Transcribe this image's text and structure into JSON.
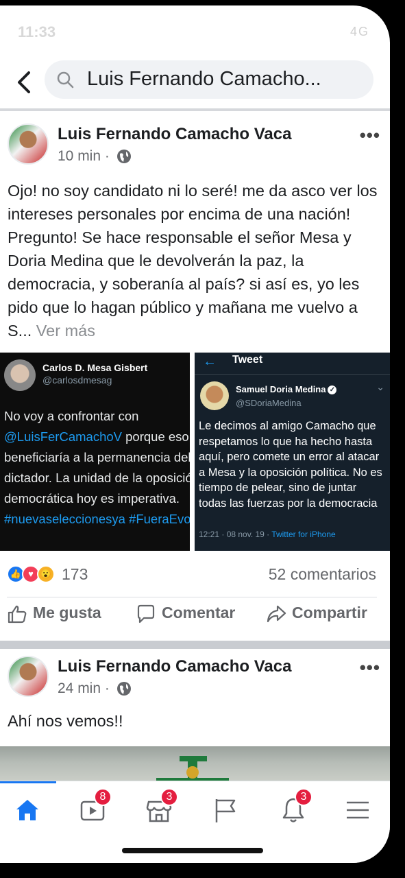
{
  "status": {
    "time": "11:33",
    "right": "4G"
  },
  "search": {
    "query": "Luis Fernando Camacho..."
  },
  "post1": {
    "author": "Luis Fernando Camacho Vaca",
    "time": "10 min",
    "text": "Ojo! no soy candidato ni lo seré! me da asco ver los intereses personales por encima de una nación!  Pregunto!  Se hace responsable el señor Mesa y Doria Medina que le devolverán la paz, la democracia, y soberanía al país? si así es, yo les pido que lo hagan público y mañana me vuelvo a S...",
    "see_more": "Ver más",
    "tweet_left": {
      "name": "Carlos D. Mesa Gisbert",
      "handle": "@carlosdmesag",
      "line1": "No voy a confrontar con",
      "mention": "@LuisFerCamachoV",
      "line2": " porque eso",
      "line3": "beneficiaría a la permanencia del",
      "line4": "dictador. La unidad de la oposición",
      "line5": "democrática hoy es imperativa.",
      "hashtags": "#nuevaseleccionesya #FueraEvo"
    },
    "tweet_right": {
      "header": "Tweet",
      "name": "Samuel Doria Medina",
      "handle": "@SDoriaMedina",
      "text": "Le decimos al amigo Camacho que respetamos lo que ha hecho hasta aquí, pero comete un error al atacar a Mesa y la oposición política. No es tiempo de pelear, sino de juntar todas las fuerzas por la democracia",
      "timestamp": "12:21 · 08 nov. 19 · ",
      "source": "Twitter for iPhone"
    },
    "reaction_count": "173",
    "comments": "52 comentarios",
    "actions": {
      "like": "Me gusta",
      "comment": "Comentar",
      "share": "Compartir"
    }
  },
  "post2": {
    "author": "Luis Fernando Camacho Vaca",
    "time": "24 min",
    "text": "Ahí nos vemos!!"
  },
  "tabbar": {
    "badges": {
      "watch": "8",
      "marketplace": "3",
      "notifications": "3"
    }
  },
  "colors": {
    "accent": "#1877f2",
    "badge": "#e41e3f",
    "twitter_blue": "#1d9bf0"
  }
}
